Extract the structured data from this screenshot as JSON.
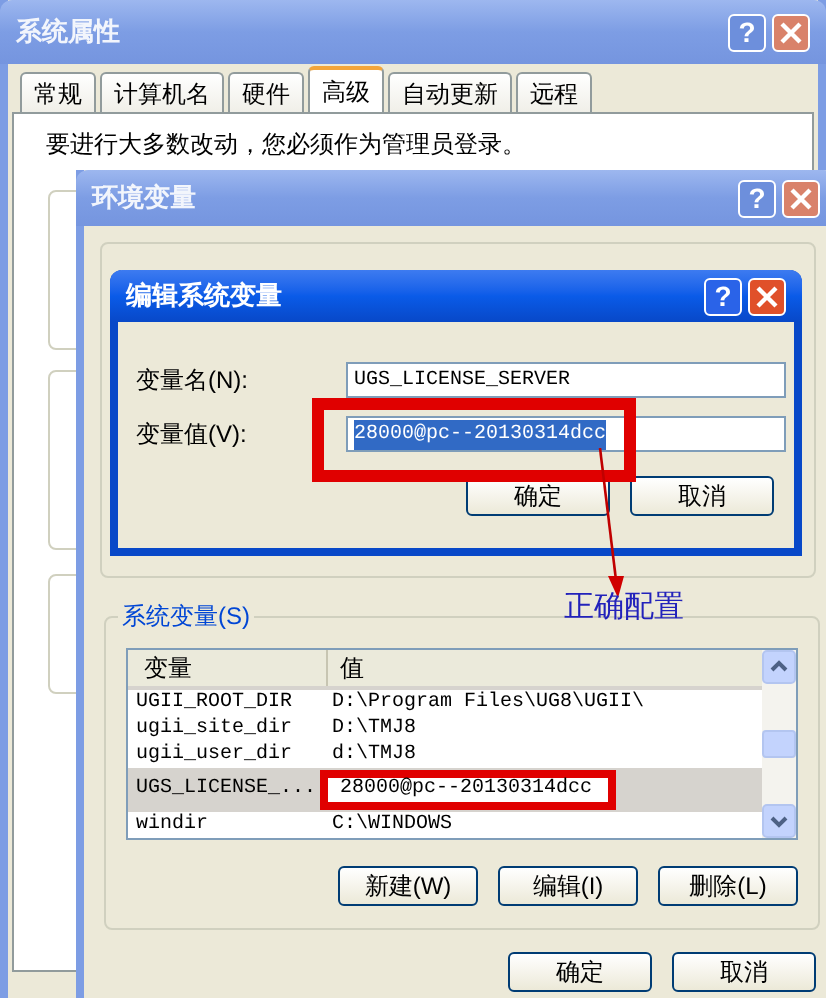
{
  "system_properties": {
    "title": "系统属性",
    "active": false,
    "help": "?",
    "tabs": [
      {
        "label": "常规",
        "selected": false
      },
      {
        "label": "计算机名",
        "selected": false
      },
      {
        "label": "硬件",
        "selected": false
      },
      {
        "label": "高级",
        "selected": true
      },
      {
        "label": "自动更新",
        "selected": false
      },
      {
        "label": "远程",
        "selected": false
      }
    ],
    "notice": "要进行大多数改动，您必须作为管理员登录。"
  },
  "environment_variables": {
    "title": "环境变量",
    "active": false,
    "help": "?",
    "system_variables": {
      "label": "系统变量(S)",
      "columns": [
        "变量",
        "值"
      ],
      "rows": [
        {
          "name": "UGII_ROOT_DIR",
          "value": "D:\\Program Files\\UG8\\UGII\\",
          "selected": false
        },
        {
          "name": "ugii_site_dir",
          "value": "D:\\TMJ8",
          "selected": false
        },
        {
          "name": "ugii_user_dir",
          "value": "d:\\TMJ8",
          "selected": false
        },
        {
          "name": "UGS_LICENSE_...",
          "value": "28000@pc--20130314dcc",
          "selected": true
        },
        {
          "name": "windir",
          "value": "C:\\WINDOWS",
          "selected": false
        }
      ],
      "buttons": [
        "新建(W)",
        "编辑(I)",
        "删除(L)"
      ]
    },
    "buttons": [
      "确定",
      "取消"
    ]
  },
  "edit_system_variable": {
    "title": "编辑系统变量",
    "active": true,
    "help": "?",
    "fields": [
      {
        "label": "变量名(N):",
        "value": "UGS_LICENSE_SERVER",
        "text_selected": false
      },
      {
        "label": "变量值(V):",
        "value": "28000@pc--20130314dcc",
        "text_selected": true
      }
    ],
    "buttons": [
      "确定",
      "取消"
    ]
  },
  "annotation": {
    "label": "正确配置"
  }
}
